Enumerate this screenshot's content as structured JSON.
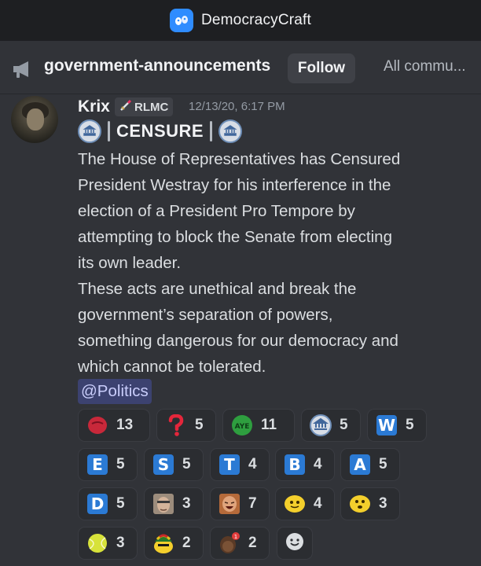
{
  "window": {
    "title": "DemocracyCraft"
  },
  "channel": {
    "name": "government-announcements",
    "follow_label": "Follow",
    "all_communities_label": "All commu..."
  },
  "message": {
    "author": "Krix",
    "role": "RLMC",
    "timestamp": "12/13/20, 6:17 PM",
    "header": "CENSURE",
    "lines": [
      "The House of Representatives has Censured",
      "President Westray for his interference in the",
      "election of a President Pro Tempore by",
      "attempting to block the Senate from electing",
      "its own leader.",
      "These acts are unethical and break the",
      "government’s separation of powers,",
      "something dangerous for our democracy and",
      "which cannot be tolerated."
    ],
    "mention": "@Politics"
  },
  "reactions": [
    {
      "icon": "red-blob-emoji",
      "count": "13"
    },
    {
      "icon": "question-emoji",
      "count": "5"
    },
    {
      "icon": "aye-emoji",
      "count": "11",
      "label": "AYE"
    },
    {
      "icon": "seal-emoji",
      "count": "5"
    },
    {
      "icon": "letter-w-emoji",
      "count": "5",
      "letter": "W"
    },
    {
      "icon": "letter-e-emoji",
      "count": "5",
      "letter": "E"
    },
    {
      "icon": "letter-s-emoji",
      "count": "5",
      "letter": "S"
    },
    {
      "icon": "letter-t-emoji",
      "count": "4",
      "letter": "T"
    },
    {
      "icon": "letter-b-emoji",
      "count": "4",
      "letter": "B"
    },
    {
      "icon": "letter-a-emoji",
      "count": "5",
      "letter": "A"
    },
    {
      "icon": "letter-d-emoji",
      "count": "5",
      "letter": "D"
    },
    {
      "icon": "man-face-emoji",
      "count": "3"
    },
    {
      "icon": "laughing-man-emoji",
      "count": "7"
    },
    {
      "icon": "yellow-blob-emoji",
      "count": "4"
    },
    {
      "icon": "yellow-blob-emoji-2",
      "count": "3"
    },
    {
      "icon": "tennis-ball-emoji",
      "count": "3"
    },
    {
      "icon": "rasta-blob-emoji",
      "count": "2"
    },
    {
      "icon": "person-notification-emoji",
      "count": "2"
    }
  ],
  "add_reaction_icon": "smiley-add-icon"
}
